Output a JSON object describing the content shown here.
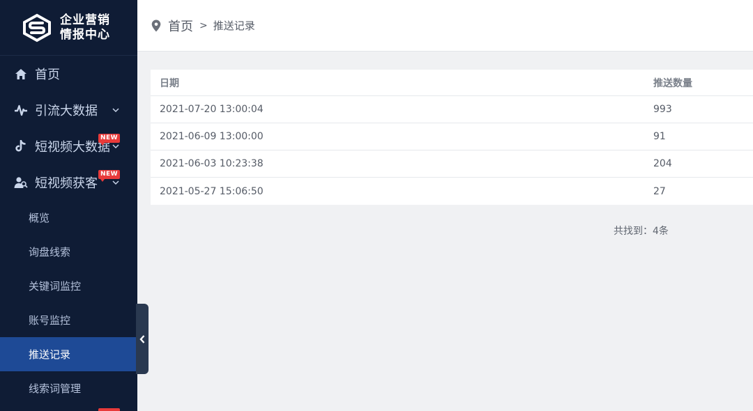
{
  "sidebar": {
    "logo": {
      "line1": "企业营销",
      "line2": "情报中心"
    },
    "nav": [
      {
        "label": "首页",
        "icon": "home-icon"
      },
      {
        "label": "引流大数据",
        "icon": "pulse-icon"
      },
      {
        "label": "短视频大数据",
        "icon": "tiktok-icon",
        "badge": "NEW"
      },
      {
        "label": "短视频获客",
        "icon": "users-icon",
        "badge": "NEW"
      }
    ],
    "sub_items": [
      {
        "label": "概览"
      },
      {
        "label": "询盘线索"
      },
      {
        "label": "关键词监控"
      },
      {
        "label": "账号监控"
      },
      {
        "label": "推送记录",
        "active": true
      },
      {
        "label": "线索词管理"
      }
    ]
  },
  "header": {
    "breadcrumb": {
      "home": "首页",
      "separator": ">",
      "current": "推送记录"
    }
  },
  "table": {
    "columns": [
      "日期",
      "推送数量"
    ],
    "rows": [
      {
        "date": "2021-07-20 13:00:04",
        "count": "993"
      },
      {
        "date": "2021-06-09 13:00:00",
        "count": "91"
      },
      {
        "date": "2021-06-03 10:23:38",
        "count": "204"
      },
      {
        "date": "2021-05-27 15:06:50",
        "count": "27"
      }
    ]
  },
  "footer": {
    "total": "共找到：4条"
  },
  "colors": {
    "sidebar_bg": "#0f1c35",
    "active_bg": "#1e4a96",
    "badge": "#e83a3a"
  }
}
